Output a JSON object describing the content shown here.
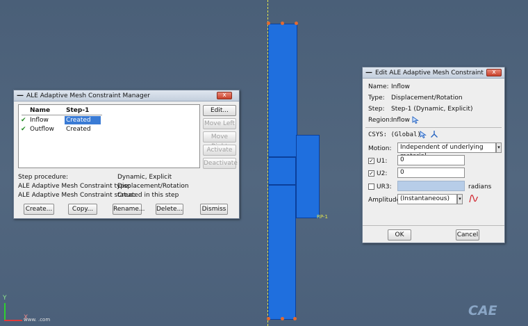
{
  "manager": {
    "title": "ALE Adaptive Mesh Constraint Manager",
    "close_label": "x",
    "col_name": "Name",
    "col_step": "Step-1",
    "rows": [
      {
        "check": "✔",
        "name": "Inflow",
        "status": "Created"
      },
      {
        "check": "✔",
        "name": "Outflow",
        "status": "Created"
      }
    ],
    "side_buttons": [
      "Edit...",
      "Move Left",
      "Move Right",
      "Activate",
      "Deactivate"
    ],
    "info": [
      {
        "label": "Step procedure:",
        "value": "Dynamic, Explicit"
      },
      {
        "label": "ALE Adaptive Mesh Constraint type:",
        "value": "Displacement/Rotation"
      },
      {
        "label": "ALE Adaptive Mesh Constraint status:",
        "value": "Created in this step"
      }
    ],
    "bottom_buttons": [
      "Create...",
      "Copy...",
      "Rename...",
      "Delete...",
      "Dismiss"
    ]
  },
  "editor": {
    "title": "Edit ALE Adaptive Mesh Constraint",
    "close_label": "x",
    "name_label": "Name:",
    "name_value": "Inflow",
    "type_label": "Type:",
    "type_value": "Displacement/Rotation",
    "step_label": "Step:",
    "step_value": "Step-1 (Dynamic, Explicit)",
    "region_label": "Region:",
    "region_value": "Inflow",
    "csys_label": "CSYS: (Global)",
    "motion_label": "Motion:",
    "motion_value": "Independent of underlying material",
    "u1_label": "U1:",
    "u1_value": "0",
    "u1_checked": "✓",
    "u2_label": "U2:",
    "u2_value": "0",
    "u2_checked": "✓",
    "ur3_label": "UR3:",
    "ur3_unit": "radians",
    "amplitude_label": "Amplitude:",
    "amplitude_value": "(Instantaneous)",
    "ok_label": "OK",
    "cancel_label": "Cancel"
  },
  "viewport": {
    "rp_label": "RP-1",
    "triad_y": "Y",
    "triad_x": "X",
    "watermark": "CAE",
    "site": "www.  .com"
  }
}
